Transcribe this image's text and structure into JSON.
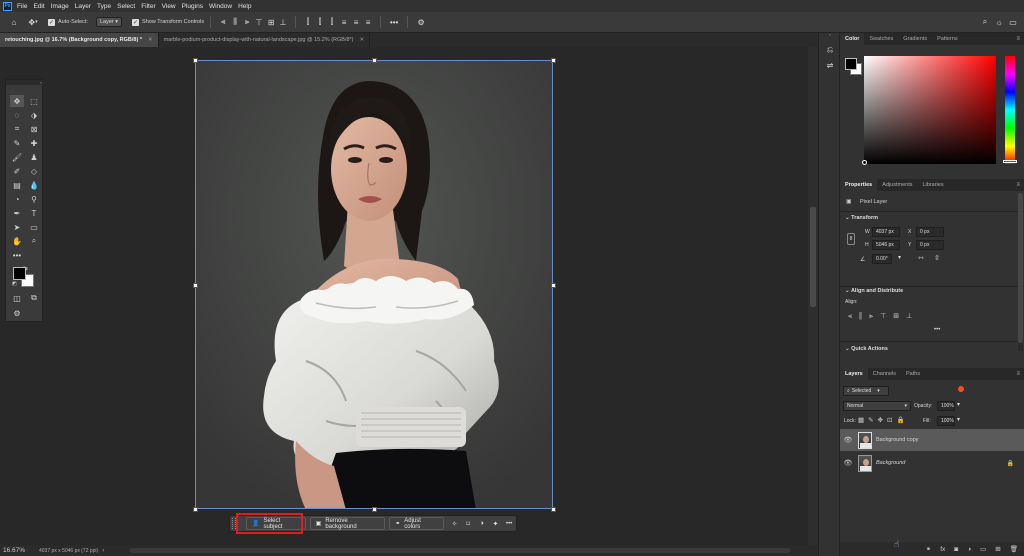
{
  "menubar": {
    "logo": "Ps",
    "items": [
      "File",
      "Edit",
      "Image",
      "Layer",
      "Type",
      "Select",
      "Filter",
      "View",
      "Plugins",
      "Window",
      "Help"
    ]
  },
  "options": {
    "auto_select_label": "Auto-Select:",
    "auto_select_target": "Layer",
    "show_transform_label": "Show Transform Controls"
  },
  "tabs": [
    {
      "label": "retouching.jpg @ 16.7% (Background copy, RGB/8) *",
      "active": true
    },
    {
      "label": "marble-podium-product-display-with-natural-landscape.jpg @ 15.2% (RGB/8*)",
      "active": false
    }
  ],
  "contextual_bar": {
    "select_subject": "Select subject",
    "remove_background": "Remove background",
    "adjust_colors": "Adjust colors"
  },
  "status": {
    "zoom": "16.67%",
    "doc_info": "4037 px x 5046 px (72 ppi)"
  },
  "color_panel": {
    "tabs": [
      "Color",
      "Swatches",
      "Gradients",
      "Patterns"
    ],
    "active_tab": "Color",
    "hue_color": "#ff0000"
  },
  "properties": {
    "tabs": [
      "Properties",
      "Adjustments",
      "Libraries"
    ],
    "layer_type": "Pixel Layer",
    "transform_title": "Transform",
    "w_label": "W",
    "w_value": "4037 px",
    "h_label": "H",
    "h_value": "5046 px",
    "x_label": "X",
    "x_value": "0 px",
    "y_label": "Y",
    "y_value": "0 px",
    "angle_value": "0.00°",
    "align_title": "Align and Distribute",
    "align_label": "Align:",
    "quick_actions_title": "Quick Actions"
  },
  "layers_panel": {
    "tabs": [
      "Layers",
      "Channels",
      "Paths"
    ],
    "filter": "Selected",
    "blend_mode": "Normal",
    "opacity_label": "Opacity:",
    "opacity_value": "100%",
    "lock_label": "Lock:",
    "fill_label": "Fill:",
    "fill_value": "100%",
    "layers": [
      {
        "name": "Background copy",
        "selected": true,
        "locked": false,
        "italic": false
      },
      {
        "name": "Background",
        "selected": false,
        "locked": true,
        "italic": true
      }
    ]
  },
  "colors": {
    "accent": "#31a8ff",
    "highlight": "#e01c1c"
  }
}
